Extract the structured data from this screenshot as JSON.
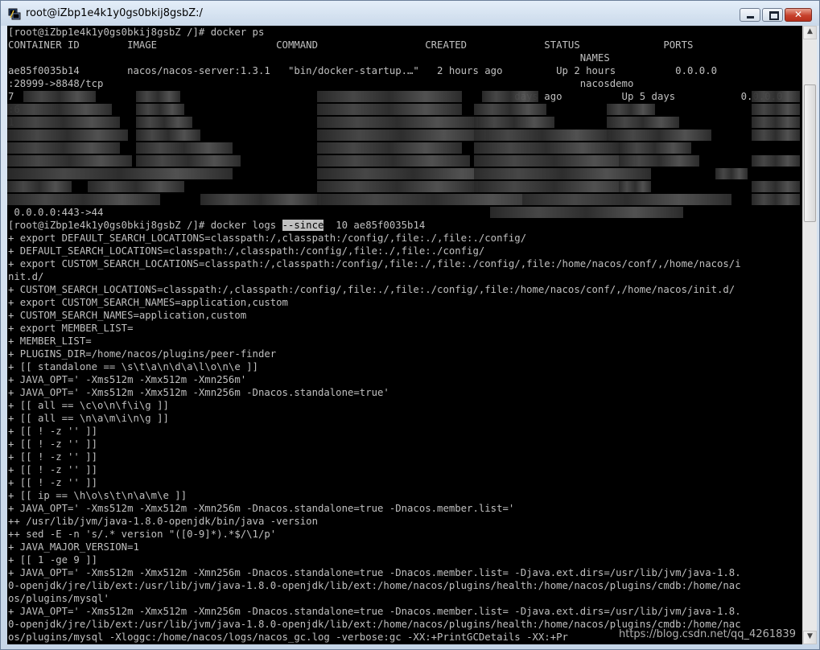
{
  "window": {
    "title": "root@iZbp1e4k1y0gs0bkij8gsbZ:/",
    "close_glyph": "✕",
    "icons": [
      "putty-app-icon",
      "minimize-icon",
      "maximize-icon",
      "close-icon"
    ]
  },
  "terminal": {
    "lines": [
      "[root@iZbp1e4k1y0gs0bkij8gsbZ /]# docker ps",
      "CONTAINER ID        IMAGE                    COMMAND                  CREATED             STATUS              PORTS",
      "                                                                                                NAMES",
      "ae85f0035b14        nacos/nacos-server:1.3.1   \"bin/docker-startup.…\"   2 hours ago         Up 2 hours          0.0.0.0",
      ":28999->8848/tcp                                                                                nacosdemo",
      "7                                                                                    days ago          Up 5 days           0.0.0.0",
      ":6",
      "1",
      "",
      "",
      "",
      "",
      "",
      "",
      " 0.0.0.0:443->44",
      "[root@iZbp1e4k1y0gs0bkij8gsbZ /]# docker logs --since  10 ae85f0035b14",
      "+ export DEFAULT_SEARCH_LOCATIONS=classpath:/,classpath:/config/,file:./,file:./config/",
      "+ DEFAULT_SEARCH_LOCATIONS=classpath:/,classpath:/config/,file:./,file:./config/",
      "+ export CUSTOM_SEARCH_LOCATIONS=classpath:/,classpath:/config/,file:./,file:./config/,file:/home/nacos/conf/,/home/nacos/i",
      "nit.d/",
      "+ CUSTOM_SEARCH_LOCATIONS=classpath:/,classpath:/config/,file:./,file:./config/,file:/home/nacos/conf/,/home/nacos/init.d/",
      "+ export CUSTOM_SEARCH_NAMES=application,custom",
      "+ CUSTOM_SEARCH_NAMES=application,custom",
      "+ export MEMBER_LIST=",
      "+ MEMBER_LIST=",
      "+ PLUGINS_DIR=/home/nacos/plugins/peer-finder",
      "+ [[ standalone == \\s\\t\\a\\n\\d\\a\\l\\o\\n\\e ]]",
      "+ JAVA_OPT=' -Xms512m -Xmx512m -Xmn256m'",
      "+ JAVA_OPT=' -Xms512m -Xmx512m -Xmn256m -Dnacos.standalone=true'",
      "+ [[ all == \\c\\o\\n\\f\\i\\g ]]",
      "+ [[ all == \\n\\a\\m\\i\\n\\g ]]",
      "+ [[ ! -z '' ]]",
      "+ [[ ! -z '' ]]",
      "+ [[ ! -z '' ]]",
      "+ [[ ! -z '' ]]",
      "+ [[ ! -z '' ]]",
      "+ [[ ip == \\h\\o\\s\\t\\n\\a\\m\\e ]]",
      "+ JAVA_OPT=' -Xms512m -Xmx512m -Xmn256m -Dnacos.standalone=true -Dnacos.member.list='",
      "++ /usr/lib/jvm/java-1.8.0-openjdk/bin/java -version",
      "++ sed -E -n 's/.* version \"([0-9]*).*$/\\1/p'",
      "+ JAVA_MAJOR_VERSION=1",
      "+ [[ 1 -ge 9 ]]",
      "+ JAVA_OPT=' -Xms512m -Xmx512m -Xmn256m -Dnacos.standalone=true -Dnacos.member.list= -Djava.ext.dirs=/usr/lib/jvm/java-1.8.",
      "0-openjdk/jre/lib/ext:/usr/lib/jvm/java-1.8.0-openjdk/lib/ext:/home/nacos/plugins/health:/home/nacos/plugins/cmdb:/home/nac",
      "os/plugins/mysql'",
      "+ JAVA_OPT=' -Xms512m -Xmx512m -Xmn256m -Dnacos.standalone=true -Dnacos.member.list= -Djava.ext.dirs=/usr/lib/jvm/java-1.8.",
      "0-openjdk/jre/lib/ext:/usr/lib/jvm/java-1.8.0-openjdk/lib/ext:/home/nacos/plugins/health:/home/nacos/plugins/cmdb:/home/nac",
      "os/plugins/mysql -Xloggc:/home/nacos/logs/nacos_gc.log -verbose:gc -XX:+PrintGCDetails -XX:+Pr"
    ],
    "command_prefix": "[root@iZbp1e4k1y0gs0bkij8gsbZ /]# docker logs ",
    "highlighted_flag": "--since",
    "command_suffix": "  10 ae85f0035b14"
  },
  "scrollbar": {
    "up_glyph": "▲",
    "down_glyph": "▼",
    "scroll_position_fraction": 0.1
  },
  "watermark": "https://blog.csdn.net/qq_4261839"
}
